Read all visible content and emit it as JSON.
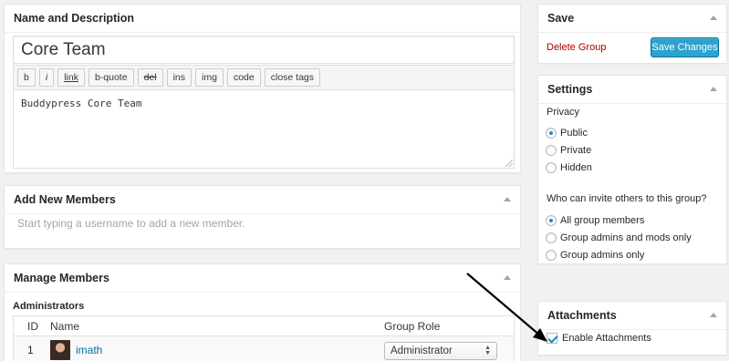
{
  "name_description": {
    "title": "Name and Description",
    "group_name": "Core Team",
    "toolbar": [
      "b",
      "i",
      "link",
      "b-quote",
      "del",
      "ins",
      "img",
      "code",
      "close tags"
    ],
    "description": "Buddypress Core Team"
  },
  "add_members": {
    "title": "Add New Members",
    "placeholder": "Start typing a username to add a new member."
  },
  "manage_members": {
    "title": "Manage Members",
    "section": "Administrators",
    "columns": {
      "id": "ID",
      "name": "Name",
      "role": "Group Role"
    },
    "rows": [
      {
        "id": "1",
        "name": "imath",
        "role": "Administrator"
      }
    ]
  },
  "save": {
    "title": "Save",
    "delete_label": "Delete Group",
    "save_label": "Save Changes"
  },
  "settings": {
    "title": "Settings",
    "privacy_label": "Privacy",
    "privacy_options": [
      "Public",
      "Private",
      "Hidden"
    ],
    "privacy_selected": "Public",
    "invite_label": "Who can invite others to this group?",
    "invite_options": [
      "All group members",
      "Group admins and mods only",
      "Group admins only"
    ],
    "invite_selected": "All group members"
  },
  "attachments": {
    "title": "Attachments",
    "enable_label": "Enable Attachments",
    "enabled": true
  },
  "colors": {
    "primary_button": "#2ea2cc",
    "delete_link": "#aa0000",
    "link": "#0073aa"
  }
}
